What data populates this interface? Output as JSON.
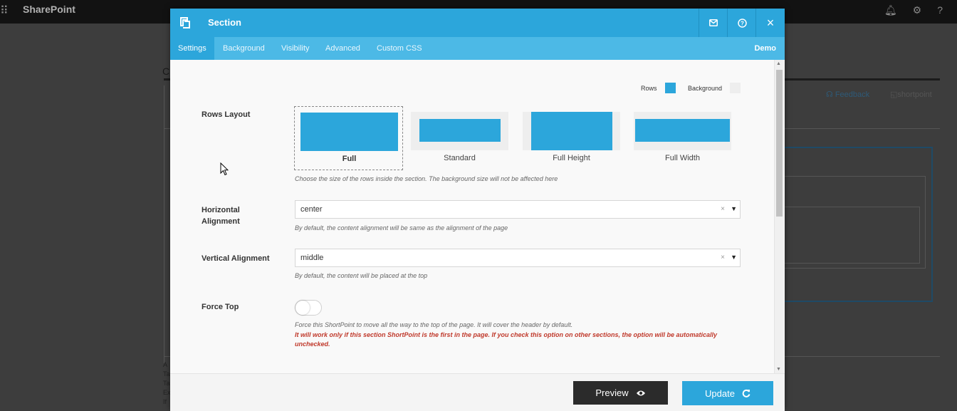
{
  "background_page": {
    "app_name": "SharePoint",
    "feedback_label": "Feedback",
    "shortpoint_label": "shortpoint",
    "partial_heading": "C",
    "partial_lines": [
      "A",
      "Ta",
      "Ta",
      "Ex",
      "If"
    ]
  },
  "dialog": {
    "title": "Section",
    "header_icons": [
      "envelope-icon",
      "help-circle-icon",
      "close-icon"
    ],
    "tabs": [
      {
        "label": "Settings",
        "active": true
      },
      {
        "label": "Background",
        "active": false
      },
      {
        "label": "Visibility",
        "active": false
      },
      {
        "label": "Advanced",
        "active": false
      },
      {
        "label": "Custom CSS",
        "active": false
      }
    ],
    "demo_label": "Demo",
    "legend": {
      "rows_label": "Rows",
      "background_label": "Background",
      "rows_color": "#2ca6db",
      "background_color": "#eeeeee"
    },
    "rows_layout": {
      "label": "Rows Layout",
      "selected": "Full",
      "options": [
        {
          "label": "Full"
        },
        {
          "label": "Standard"
        },
        {
          "label": "Full Height"
        },
        {
          "label": "Full Width"
        }
      ],
      "help": "Choose the size of the rows inside the section. The background size will not be affected here"
    },
    "horizontal_alignment": {
      "label": "Horizontal Alignment",
      "value": "center",
      "clear": "×",
      "arrow": "▼",
      "help": "By default, the content alignment will be same as the alignment of the page"
    },
    "vertical_alignment": {
      "label": "Vertical Alignment",
      "value": "middle",
      "clear": "×",
      "arrow": "▼",
      "help": "By default, the content will be placed at the top"
    },
    "force_top": {
      "label": "Force Top",
      "checked": false,
      "help": "Force this ShortPoint to move all the way to the top of the page. It will cover the header by default.",
      "warning": "It will work only if this section ShortPoint is the first in the page. If you check this option on other sections, the option will be automatically unchecked."
    },
    "footer": {
      "preview_label": "Preview",
      "update_label": "Update"
    }
  },
  "colors": {
    "accent": "#2ca6db",
    "tab_bar": "#4cb9e6",
    "preview_button": "#2b2b2b",
    "warning_text": "#c0392b"
  }
}
